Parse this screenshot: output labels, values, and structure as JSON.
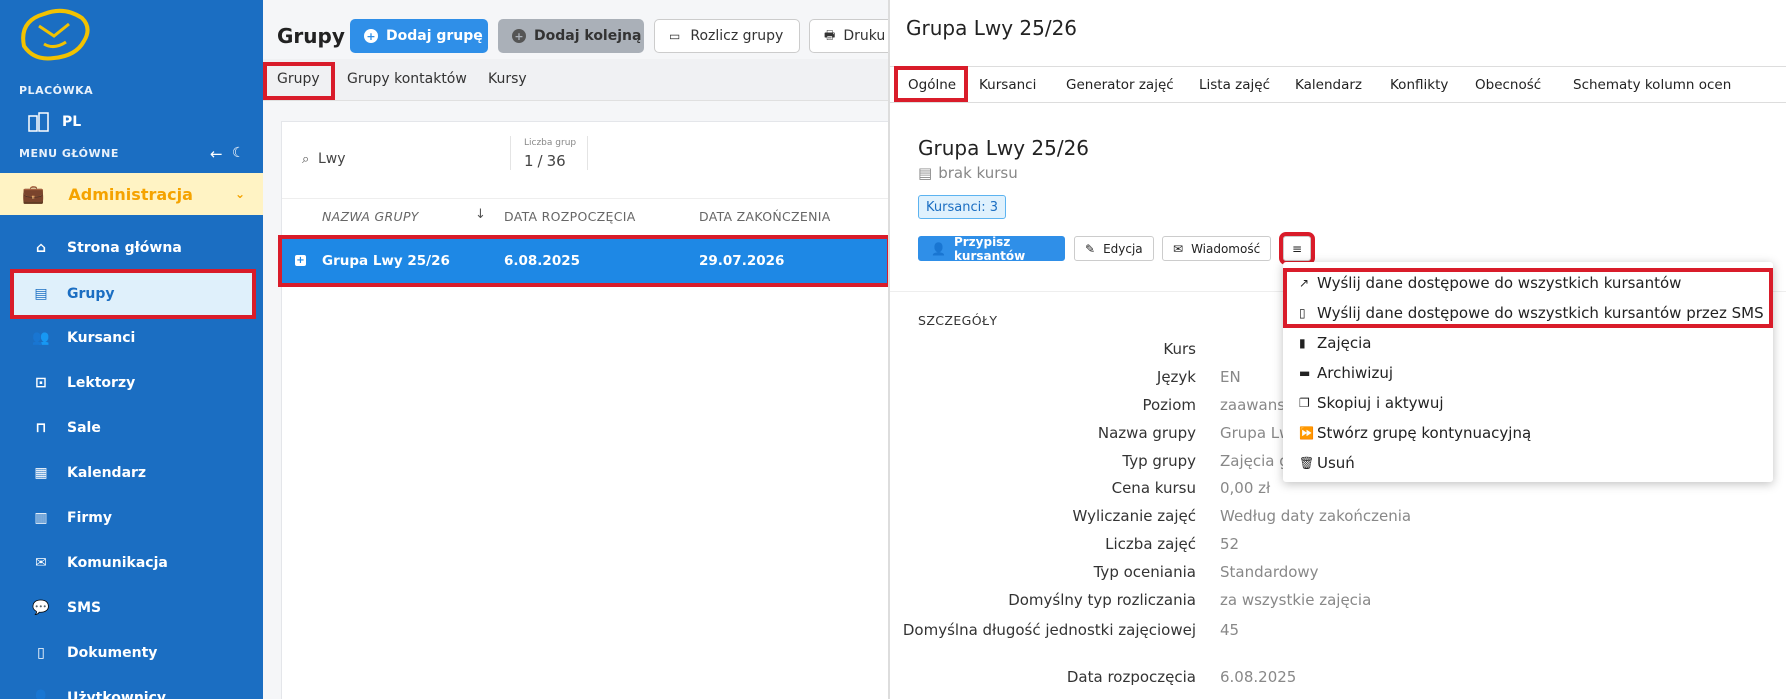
{
  "sidebar": {
    "placowka_label": "PLACÓWKA",
    "placowka_value": "PL",
    "menu_label": "MENU GŁÓWNE",
    "admin_label": "Administracja",
    "items": [
      {
        "label": "Strona główna",
        "icon": "home-icon"
      },
      {
        "label": "Grupy",
        "icon": "book-icon"
      },
      {
        "label": "Kursanci",
        "icon": "users-icon"
      },
      {
        "label": "Lektorzy",
        "icon": "teacher-icon"
      },
      {
        "label": "Sale",
        "icon": "door-icon"
      },
      {
        "label": "Kalendarz",
        "icon": "calendar-icon"
      },
      {
        "label": "Firmy",
        "icon": "building-icon"
      },
      {
        "label": "Komunikacja",
        "icon": "mail-icon"
      },
      {
        "label": "SMS",
        "icon": "chat-icon"
      },
      {
        "label": "Dokumenty",
        "icon": "document-icon"
      },
      {
        "label": "Użytkownicy",
        "icon": "user-icon"
      }
    ]
  },
  "groups": {
    "title": "Grupy",
    "add_label": "Dodaj grupę",
    "add_next_label": "Dodaj kolejną",
    "settle_label": "Rozlicz grupy",
    "print_label": "Druku",
    "tabs": [
      "Grupy",
      "Grupy kontaktów",
      "Kursy"
    ],
    "search_value": "Lwy",
    "count_label": "Liczba grup",
    "count_current": "1",
    "count_sep": "/",
    "count_total": "36",
    "columns": [
      "NAZWA GRUPY",
      "DATA ROZPOCZĘCIA",
      "DATA ZAKOŃCZENIA"
    ],
    "rows": [
      {
        "name": "Grupa Lwy 25/26",
        "start": "6.08.2025",
        "end": "29.07.2026"
      }
    ]
  },
  "detail": {
    "header": "Grupa Lwy 25/26",
    "tabs": [
      "Ogólne",
      "Kursanci",
      "Generator zajęć",
      "Lista zajęć",
      "Kalendarz",
      "Konflikty",
      "Obecność",
      "Schematy kolumn ocen"
    ],
    "title": "Grupa Lwy 25/26",
    "course": "brak kursu",
    "badge": "Kursanci: 3",
    "assign_label": "Przypisz kursantów",
    "edit_label": "Edycja",
    "message_label": "Wiadomość",
    "section": "SZCZEGÓŁY",
    "fields": [
      {
        "label": "Kurs",
        "value": ""
      },
      {
        "label": "Język",
        "value": "EN"
      },
      {
        "label": "Poziom",
        "value": "zaawans"
      },
      {
        "label": "Nazwa grupy",
        "value": "Grupa Lw"
      },
      {
        "label": "Typ grupy",
        "value": "Zajęcia g"
      },
      {
        "label": "Cena kursu",
        "value": "0,00 zł"
      },
      {
        "label": "Wyliczanie zajęć",
        "value": "Według daty zakończenia"
      },
      {
        "label": "Liczba zajęć",
        "value": "52"
      },
      {
        "label": "Typ oceniania",
        "value": "Standardowy"
      },
      {
        "label": "Domyślny typ rozliczania",
        "value": "za wszystkie zajęcia"
      },
      {
        "label": "Domyślna długość jednostki zajęciowej",
        "value": "45"
      },
      {
        "label": "Data rozpoczęcia",
        "value": "6.08.2025"
      }
    ],
    "menu": [
      {
        "label": "Wyślij dane dostępowe do wszystkich kursantów",
        "icon": "share-icon"
      },
      {
        "label": "Wyślij dane dostępowe do wszystkich kursantów przez SMS",
        "icon": "phone-icon"
      },
      {
        "label": "Zajęcia",
        "icon": "file-icon"
      },
      {
        "label": "Archiwizuj",
        "icon": "folder-icon"
      },
      {
        "label": "Skopiuj i aktywuj",
        "icon": "copy-icon"
      },
      {
        "label": "Stwórz grupę kontynuacyjną",
        "icon": "forward-icon"
      },
      {
        "label": "Usuń",
        "icon": "trash-icon"
      }
    ]
  },
  "colors": {
    "sidebar": "#1b6ec2",
    "accent": "#2f8fe8",
    "highlight": "#d91c2a",
    "admin_bg": "#fff3c4"
  }
}
